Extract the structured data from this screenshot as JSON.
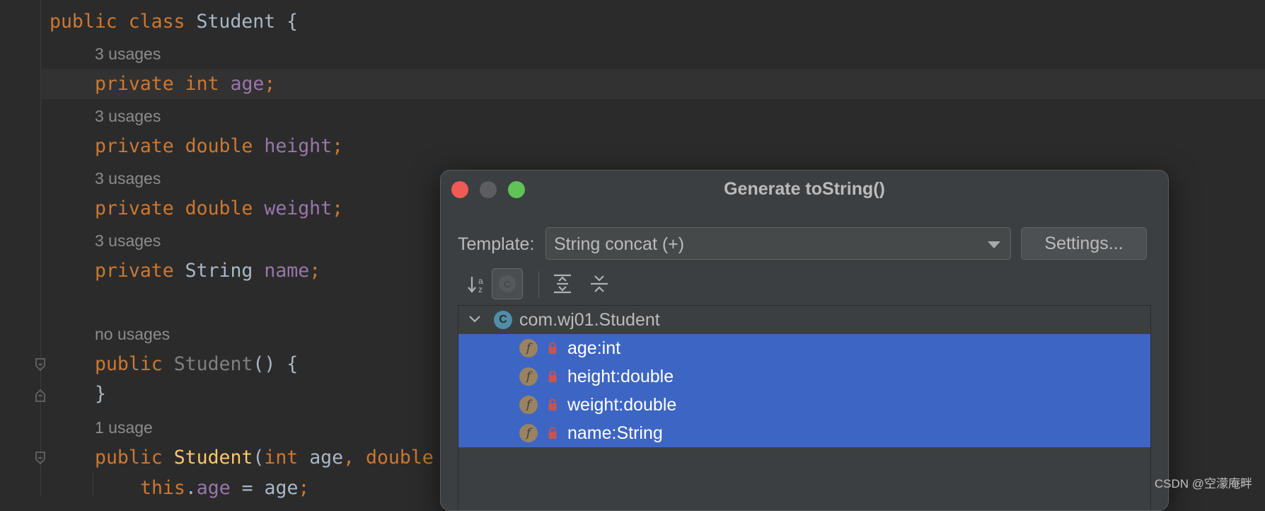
{
  "editor": {
    "lines": {
      "class_decl": {
        "kw1": "public",
        "kw2": "class",
        "name": "Student",
        "brace": "{"
      },
      "hint1": "3 usages",
      "field1": {
        "kw": "private",
        "type": "int",
        "name": "age",
        "semi": ";"
      },
      "hint2": "3 usages",
      "field2": {
        "kw": "private",
        "type": "double",
        "name": "height",
        "semi": ";"
      },
      "hint3": "3 usages",
      "field3": {
        "kw": "private",
        "type": "double",
        "name": "weight",
        "semi": ";"
      },
      "hint4": "3 usages",
      "field4": {
        "kw": "private",
        "type": "String",
        "name": "name",
        "semi": ";"
      },
      "hint5": "no usages",
      "ctor1": {
        "kw": "public",
        "name": "Student",
        "rest": "() {"
      },
      "ctor1_close": "}",
      "hint6": "1 usage",
      "ctor2": {
        "kw": "public",
        "name": "Student",
        "paren": "(",
        "t1": "int",
        "p1": " age",
        "comma": ",",
        "t2": "double"
      },
      "assign": {
        "kw": "this",
        "dot": ".",
        "field": "age",
        "rest": " = age",
        "semi": ";"
      }
    }
  },
  "dialog": {
    "title": "Generate toString()",
    "template_label": "Template:",
    "template_value": "String concat (+)",
    "settings_label": "Settings...",
    "toolbar": [
      "sort-alpha-icon",
      "inherited-members-icon",
      "expand-all-icon",
      "collapse-all-icon"
    ],
    "tree": {
      "root": {
        "icon": "C",
        "label": "com.wj01.Student"
      },
      "items": [
        {
          "icon": "f",
          "label": "age:int"
        },
        {
          "icon": "f",
          "label": "height:double"
        },
        {
          "icon": "f",
          "label": "weight:double"
        },
        {
          "icon": "f",
          "label": "name:String"
        }
      ]
    }
  },
  "watermark": "CSDN @空濛庵畔",
  "colors": {
    "editor_bg": "#2b2b2b",
    "keyword": "#cc7832",
    "field": "#9876aa",
    "method": "#ffc66d",
    "selection": "#3d65c4",
    "dialog_bg": "#3c3f41"
  }
}
